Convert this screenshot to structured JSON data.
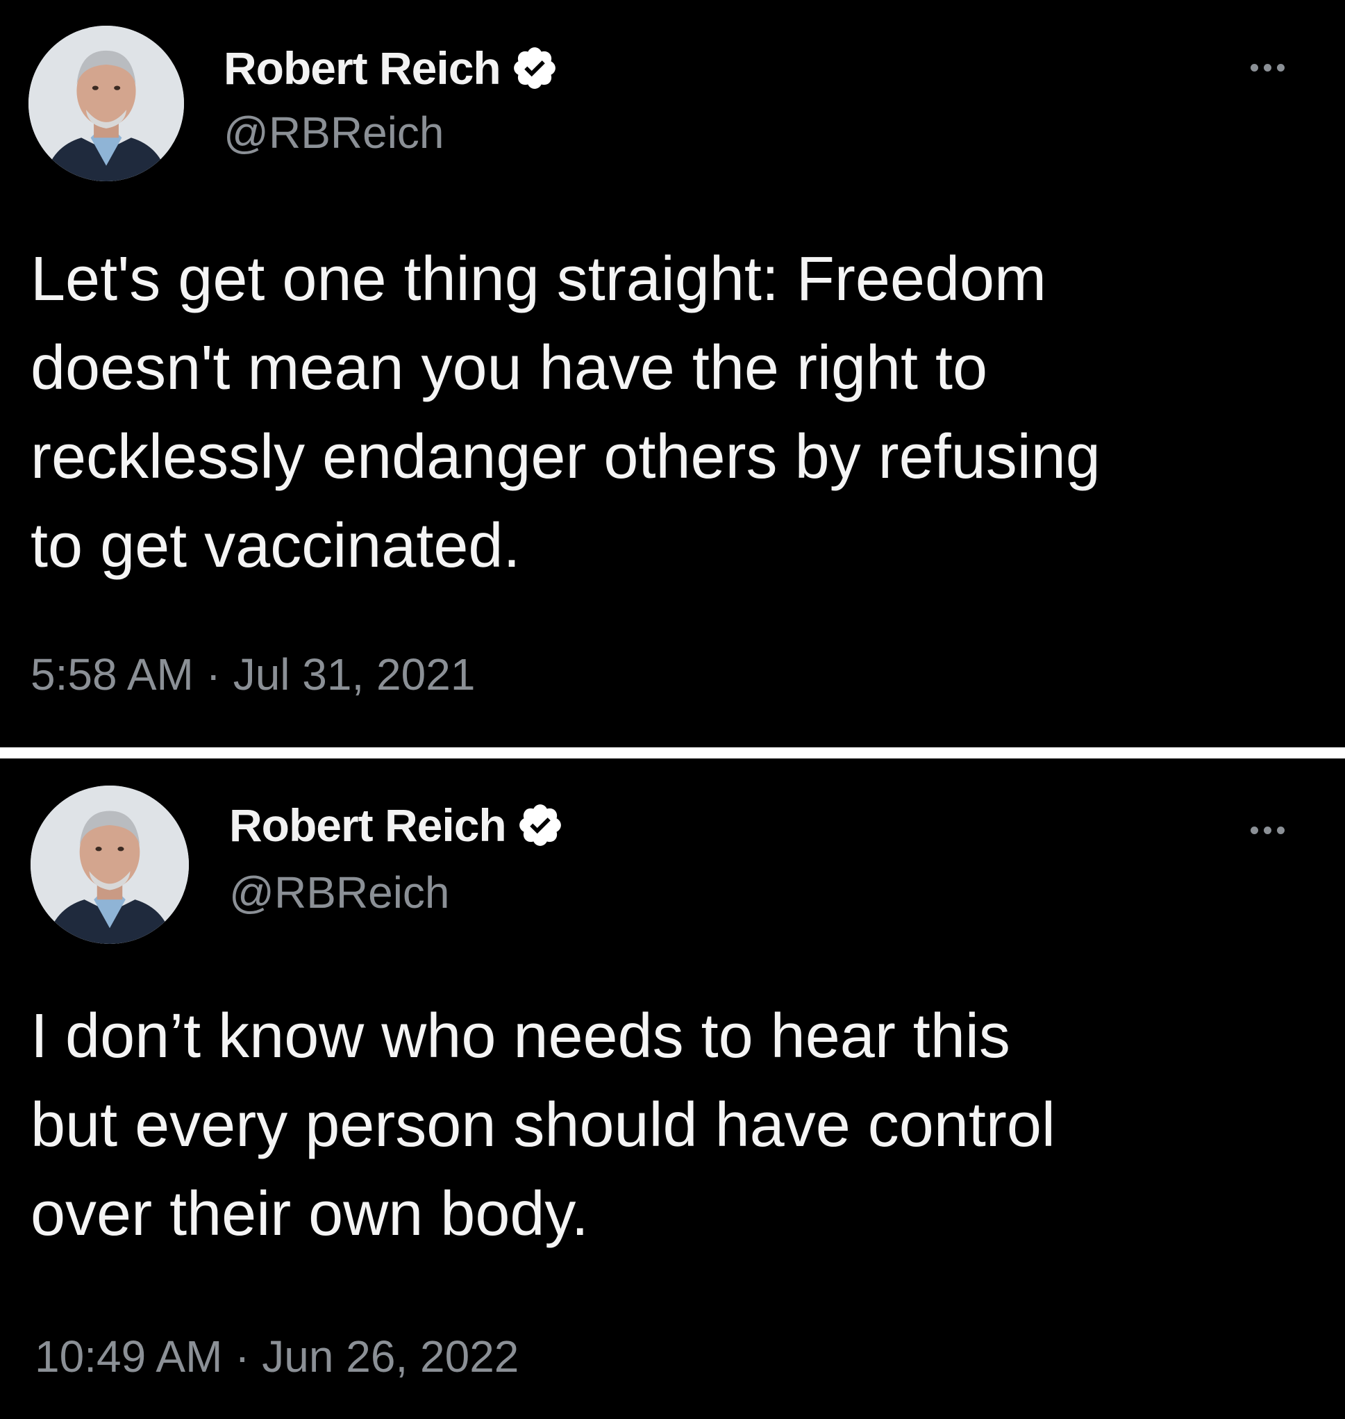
{
  "tweets": [
    {
      "author": {
        "name": "Robert Reich",
        "handle": "@RBReich"
      },
      "text_lines": [
        "Let's get one thing straight: Freedom",
        "doesn't mean you have the right to",
        "recklessly endanger others by refusing",
        "to get vaccinated."
      ],
      "time": "5:58 AM",
      "separator": "·",
      "date": "Jul 31, 2021",
      "icons": {
        "verified": "verified-badge-icon",
        "more": "more-options-icon"
      }
    },
    {
      "author": {
        "name": "Robert Reich",
        "handle": "@RBReich"
      },
      "text_lines": [
        "I don’t know who needs to hear this",
        "but every person should have control",
        "over their own body."
      ],
      "time": "10:49 AM",
      "separator": "·",
      "date": "Jun 26, 2022",
      "icons": {
        "verified": "verified-badge-icon",
        "more": "more-options-icon"
      }
    }
  ],
  "colors": {
    "background": "#000000",
    "text": "#f4f4f4",
    "secondary": "#8b9096",
    "divider": "#ffffff"
  }
}
